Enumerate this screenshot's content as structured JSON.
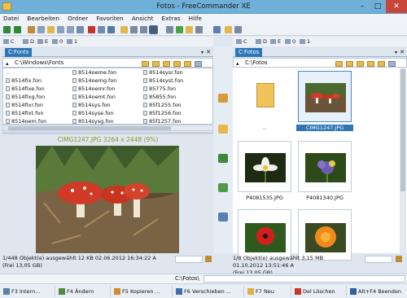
{
  "window": {
    "title": "Fotos - FreeCommander XE",
    "min": "–",
    "max": "□",
    "close": "✕"
  },
  "menu": [
    "Datei",
    "Bearbeiten",
    "Ordner",
    "Favoriten",
    "Ansicht",
    "Extras",
    "Hilfe"
  ],
  "drives_left": [
    "C",
    "D",
    "E",
    "0",
    "1"
  ],
  "drives_right": [
    "C",
    "D",
    "E",
    "0",
    "1"
  ],
  "left": {
    "tab": "C:Fonts",
    "path": "C:\\Windows\\Fonts",
    "files": [
      [
        "..",
        "8514fix.fon",
        "8514fixe.fon",
        "8514fixg.fon",
        "8514fixr.fon",
        "8514fixt.fon",
        "8514oem.fon"
      ],
      [
        "8514oeme.fon",
        "8514oemg.fon",
        "8514oemr.fon",
        "8514oemt.fon",
        "8514sys.fon",
        "8514syse.fon",
        "8514sysg.fon"
      ],
      [
        "8514sysr.fon",
        "8514syst.fon",
        "85775.fon",
        "85855.fon",
        "85f1255.fon",
        "85f1256.fon",
        "85f1257.fon"
      ]
    ],
    "preview_title": "CIMG1247.JPG  3264 x 2448 (9%)",
    "status1": "1/448 Objekt(e) ausgewählt     12 KB    02.06.2012 16:34:22    A",
    "status2": "(Frei 13,05 GB)"
  },
  "right": {
    "tab": "C:Fotos",
    "path": "C:\\Fotos",
    "thumbs": [
      {
        "label": "..",
        "kind": "folder",
        "selected": false
      },
      {
        "label": "CIMG1247.JPG",
        "kind": "mushroom",
        "selected": true
      },
      {
        "label": "P4081535.JPG",
        "kind": "white-flower",
        "selected": false
      },
      {
        "label": "P4081340.JPG",
        "kind": "purple-flower",
        "selected": false
      },
      {
        "label": "",
        "kind": "red-flower",
        "selected": false
      },
      {
        "label": "",
        "kind": "orange-flower",
        "selected": false
      }
    ],
    "status1": "1/8 Objekt(e) ausgewählt     3,15 MB",
    "status1b": "01.10.2012 13:51:46    A",
    "status2": "(Frei 13,05 GB)"
  },
  "cmdline": "C:\\Fotos\\",
  "fkeys": [
    {
      "label": "F3 Intern...",
      "color": "#5c7fa8"
    },
    {
      "label": "F4 Ändern",
      "color": "#4f8a3c"
    },
    {
      "label": "F5 Kopieren ...",
      "color": "#d08a2a"
    },
    {
      "label": "F6 Verschieben ...",
      "color": "#3b6fb0"
    },
    {
      "label": "F7 Neu",
      "color": "#e0b341"
    },
    {
      "label": "Del Löschen",
      "color": "#c9342d"
    },
    {
      "label": "Alt+F4 Beenden",
      "color": "#2f5e9e"
    }
  ]
}
